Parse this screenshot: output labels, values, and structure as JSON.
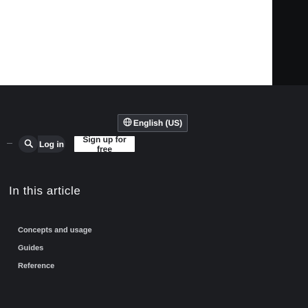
{
  "header": {
    "search_icon": "search-icon",
    "login_label": "Log in",
    "signup_label": "Sign up for free"
  },
  "language": {
    "icon": "globe-icon",
    "label": "English (US)"
  },
  "article_nav": {
    "title": "In this article",
    "items": [
      {
        "label": "Concepts and usage"
      },
      {
        "label": "Guides"
      },
      {
        "label": "Reference"
      }
    ]
  }
}
